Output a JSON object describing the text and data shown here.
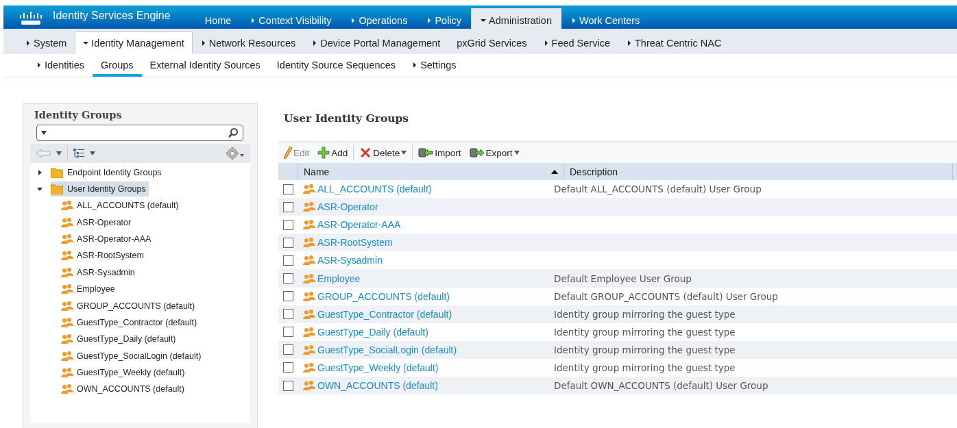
{
  "header": {
    "brand": "Identity Services Engine",
    "tabs": [
      {
        "label": "Home",
        "has_menu": false,
        "selected": false
      },
      {
        "label": "Context Visibility",
        "has_menu": true,
        "selected": false
      },
      {
        "label": "Operations",
        "has_menu": true,
        "selected": false
      },
      {
        "label": "Policy",
        "has_menu": true,
        "selected": false
      },
      {
        "label": "Administration",
        "has_menu": true,
        "selected": true
      },
      {
        "label": "Work Centers",
        "has_menu": true,
        "selected": false
      }
    ]
  },
  "subnav": [
    {
      "label": "System",
      "has_menu": true,
      "selected": false
    },
    {
      "label": "Identity Management",
      "has_menu": true,
      "selected": true
    },
    {
      "label": "Network Resources",
      "has_menu": true,
      "selected": false
    },
    {
      "label": "Device Portal Management",
      "has_menu": true,
      "selected": false
    },
    {
      "label": "pxGrid Services",
      "has_menu": false,
      "selected": false
    },
    {
      "label": "Feed Service",
      "has_menu": true,
      "selected": false
    },
    {
      "label": "Threat Centric NAC",
      "has_menu": true,
      "selected": false
    }
  ],
  "thirdnav": [
    {
      "label": "Identities",
      "has_menu": true,
      "selected": false
    },
    {
      "label": "Groups",
      "has_menu": false,
      "selected": true
    },
    {
      "label": "External Identity Sources",
      "has_menu": false,
      "selected": false
    },
    {
      "label": "Identity Source Sequences",
      "has_menu": false,
      "selected": false
    },
    {
      "label": "Settings",
      "has_menu": true,
      "selected": false
    }
  ],
  "sidebar": {
    "title": "Identity Groups",
    "tree": [
      {
        "label": "Endpoint Identity Groups",
        "expanded": false,
        "selected": false
      },
      {
        "label": "User Identity Groups",
        "expanded": true,
        "selected": true,
        "children": [
          {
            "label": "ALL_ACCOUNTS (default)"
          },
          {
            "label": "ASR-Operator"
          },
          {
            "label": "ASR-Operator-AAA"
          },
          {
            "label": "ASR-RootSystem"
          },
          {
            "label": "ASR-Sysadmin"
          },
          {
            "label": "Employee"
          },
          {
            "label": "GROUP_ACCOUNTS (default)"
          },
          {
            "label": "GuestType_Contractor (default)"
          },
          {
            "label": "GuestType_Daily (default)"
          },
          {
            "label": "GuestType_SocialLogin (default)"
          },
          {
            "label": "GuestType_Weekly (default)"
          },
          {
            "label": "OWN_ACCOUNTS (default)"
          }
        ]
      }
    ]
  },
  "main": {
    "title": "User Identity Groups",
    "toolbar": [
      {
        "label": "Edit",
        "kind": "edit",
        "disabled": true,
        "dropdown": false
      },
      {
        "label": "Add",
        "kind": "add",
        "disabled": false,
        "dropdown": false
      },
      {
        "label": "Delete",
        "kind": "delete",
        "disabled": false,
        "dropdown": true
      },
      {
        "label": "Import",
        "kind": "import",
        "disabled": false,
        "dropdown": false
      },
      {
        "label": "Export",
        "kind": "export",
        "disabled": false,
        "dropdown": true
      }
    ],
    "columns": [
      {
        "label": "Name",
        "sorted": true
      },
      {
        "label": "Description",
        "sorted": false
      }
    ],
    "rows": [
      {
        "name": "ALL_ACCOUNTS (default)",
        "description": "Default ALL_ACCOUNTS (default) User Group",
        "checked": false
      },
      {
        "name": "ASR-Operator",
        "checked": false
      },
      {
        "name": "ASR-Operator-AAA",
        "checked": false
      },
      {
        "name": "ASR-RootSystem",
        "checked": false
      },
      {
        "name": "ASR-Sysadmin",
        "checked": false
      },
      {
        "name": "Employee",
        "description": "Default Employee User Group",
        "checked": false
      },
      {
        "name": "GROUP_ACCOUNTS (default)",
        "description": "Default GROUP_ACCOUNTS (default) User Group",
        "checked": false
      },
      {
        "name": "GuestType_Contractor (default)",
        "description": "Identity group mirroring the guest type",
        "checked": false
      },
      {
        "name": "GuestType_Daily (default)",
        "description": "Identity group mirroring the guest type",
        "checked": false
      },
      {
        "name": "GuestType_SocialLogin (default)",
        "description": "Identity group mirroring the guest type",
        "checked": false
      },
      {
        "name": "GuestType_Weekly (default)",
        "description": "Identity group mirroring the guest type",
        "checked": false
      },
      {
        "name": "OWN_ACCOUNTS (default)",
        "description": "Default OWN_ACCOUNTS (default) User Group",
        "checked": false
      }
    ]
  }
}
